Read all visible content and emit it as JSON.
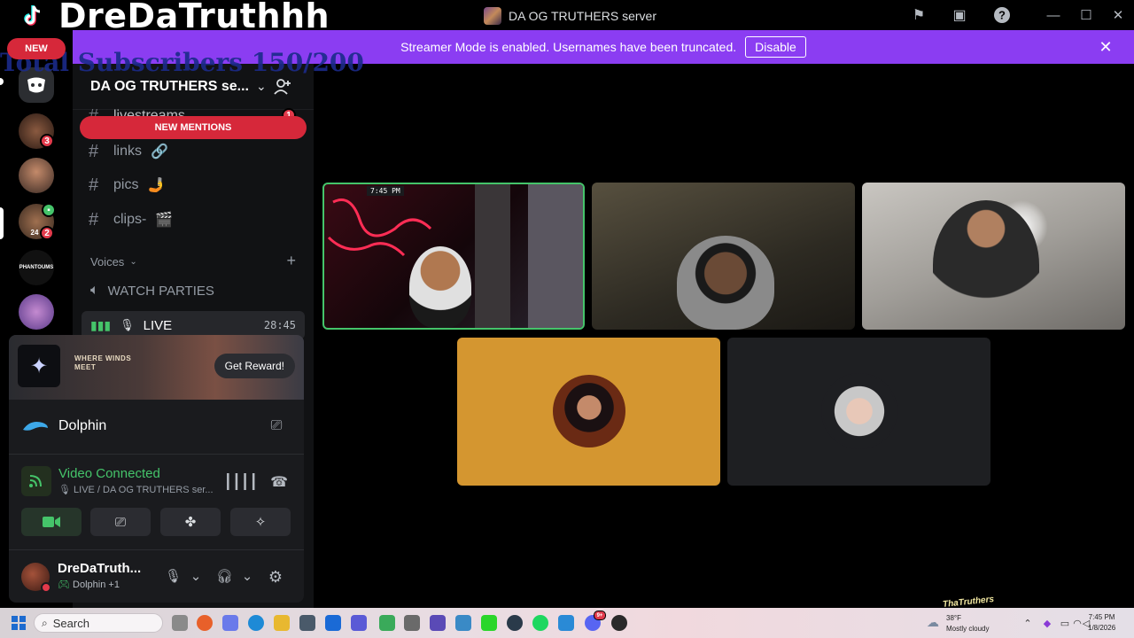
{
  "overlay": {
    "streamer_name": "DreDaTruthhh",
    "new_label": "NEW",
    "subscribers_text": "Total Subscribers 150/200"
  },
  "titlebar": {
    "server_title": "DA OG TRUTHERS server",
    "icons": [
      "flag-icon",
      "inbox-icon",
      "help-icon"
    ],
    "window_controls": [
      "minimize",
      "maximize",
      "close"
    ]
  },
  "banner": {
    "text": "Streamer Mode is enabled. Usernames have been truncated.",
    "button_label": "Disable",
    "color": "#8b3df2"
  },
  "rail": {
    "badges": [
      "3",
      "24",
      "2"
    ],
    "labels": [
      "PHANTOUMS"
    ]
  },
  "sidebar": {
    "server_name": "DA OG TRUTHERS se...",
    "new_mentions": "NEW MENTIONS",
    "partial_channel": "livestreams",
    "partial_badge": "1",
    "text_channels": [
      {
        "name": "links",
        "emoji": "🔗"
      },
      {
        "name": "pics",
        "emoji": "🤳"
      },
      {
        "name": "clips-",
        "emoji": "🎬"
      }
    ],
    "voices_header": "Voices",
    "voice_channels": [
      {
        "name": "WATCH PARTIES"
      },
      {
        "name": "LIVE",
        "timer": "28:45"
      }
    ]
  },
  "panel": {
    "promo_game": "WHERE WINDS MEET",
    "reward_button": "Get Reward!",
    "activity_name": "Dolphin",
    "voice_status": "Video Connected",
    "voice_location": "LIVE / DA OG TRUTHERS ser...",
    "user": {
      "name": "DreDaTruth...",
      "activity": "Dolphin +1"
    }
  },
  "stage": {
    "clock_overlay": "7:45 PM",
    "tile_colors": [
      "#d49630",
      "#1e1f22"
    ],
    "speaking_color": "#45c46a"
  },
  "watermark": "ThaTruthers",
  "taskbar": {
    "search_placeholder": "Search",
    "weather_temp": "38°F",
    "weather_desc": "Mostly cloudy",
    "time": "7:45 PM",
    "date": "1/8/2026",
    "notification_badge": "9+"
  }
}
